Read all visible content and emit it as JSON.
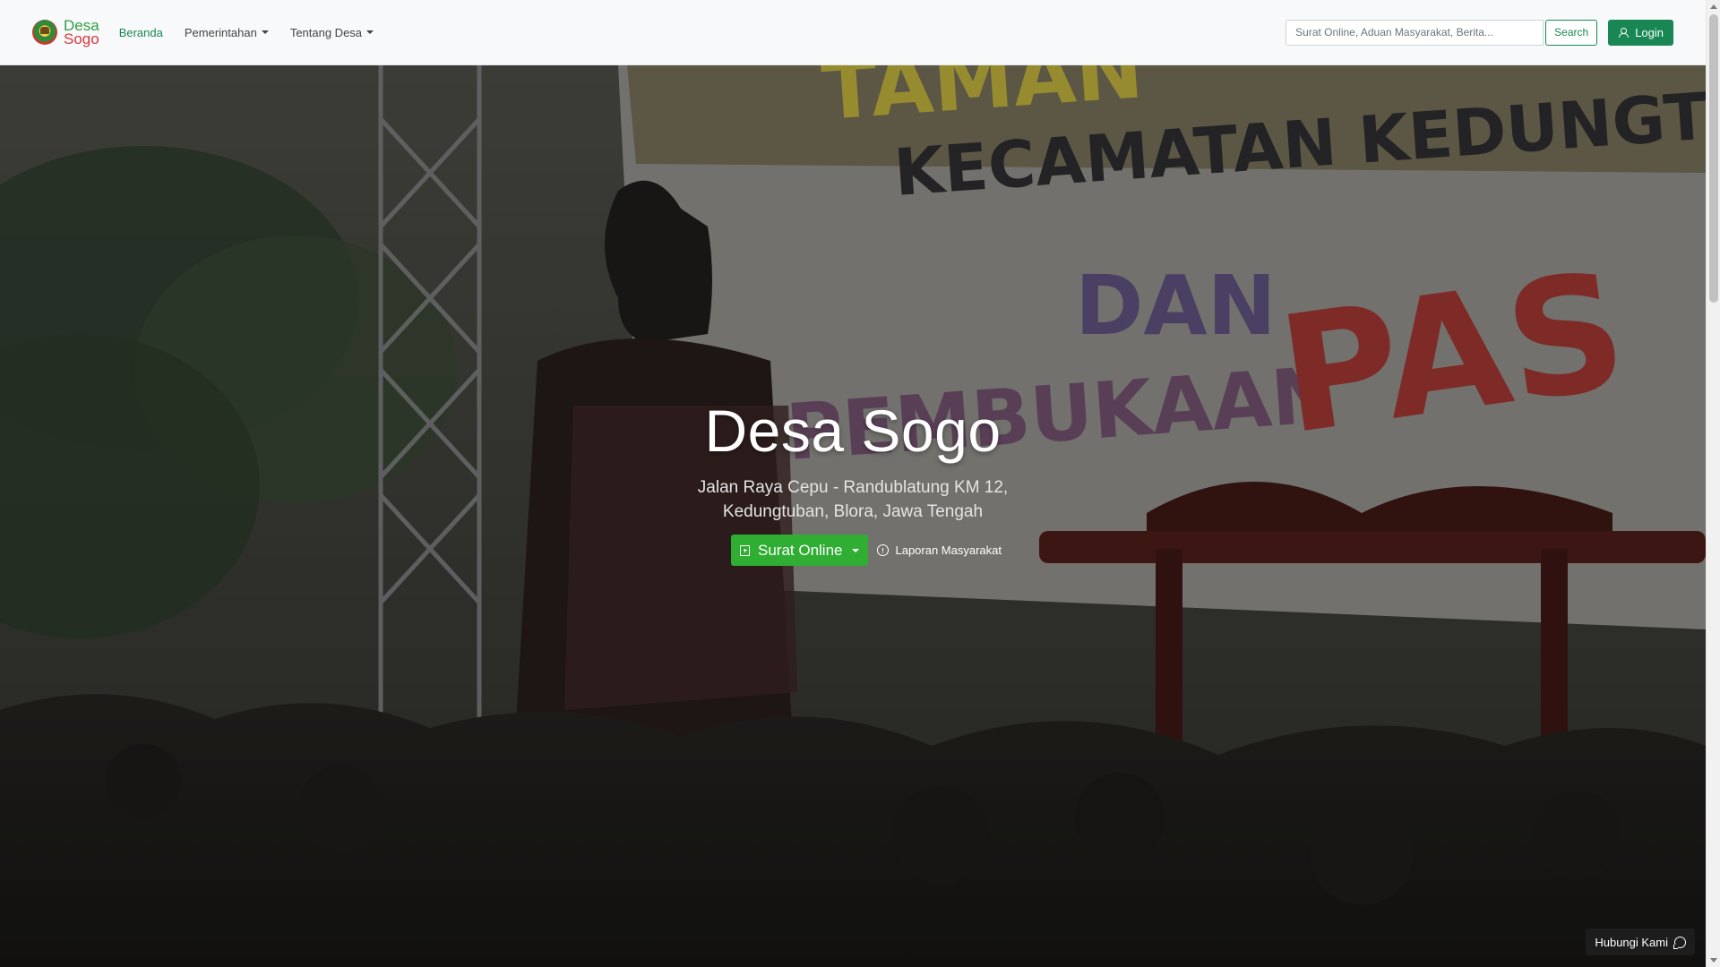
{
  "brand": {
    "line1": "Desa",
    "line2": "Sogo"
  },
  "nav": {
    "items": [
      {
        "label": "Beranda"
      },
      {
        "label": "Pemerintahan"
      },
      {
        "label": "Tentang Desa"
      }
    ]
  },
  "search": {
    "placeholder": "Surat Online, Aduan Masyarakat, Berita...",
    "button_label": "Search"
  },
  "login": {
    "label": "Login"
  },
  "hero": {
    "title": "Desa Sogo",
    "subtitle_line1": "Jalan Raya Cepu - Randublatung KM 12,",
    "subtitle_line2": "Kedungtuban, Blora, Jawa Tengah",
    "primary_button": "Surat Online",
    "secondary_link": "Laporan Masyarakat",
    "banner_text_1": "TAMAN",
    "banner_text_2": "KECAMATAN KEDUNGTUBA",
    "banner_text_3": "DAN",
    "banner_text_4": "PEMBUKAAN",
    "banner_text_5": "PAS"
  },
  "contact": {
    "label": "Hubungi Kami"
  },
  "colors": {
    "primary": "#198754",
    "hero_button": "#2fae33",
    "brand_green": "#2f9e44",
    "brand_red": "#d9363e"
  }
}
